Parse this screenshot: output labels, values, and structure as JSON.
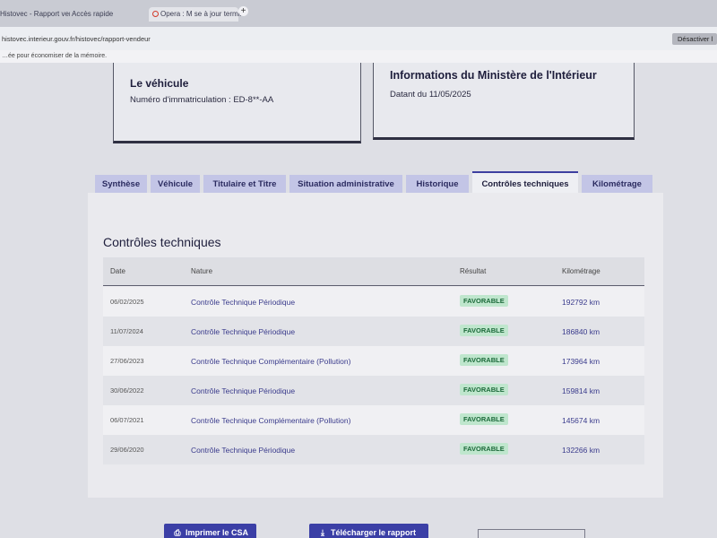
{
  "browser": {
    "tabs": [
      {
        "label": "Histovec - Rapport vende"
      },
      {
        "label": "Accès rapide"
      },
      {
        "label": "Opera : M se à jour termin"
      }
    ],
    "new_tab_symbol": "+",
    "url": "histovec.interieur.gouv.fr/histovec/rapport-vendeur",
    "disable_button": "Désactiver l",
    "infobar_text": "…ée pour économiser de la mémoire."
  },
  "vehicle_card": {
    "title": "Le véhicule",
    "plate_label": "Numéro d'immatriculation : ED-8**-AA"
  },
  "ministry_card": {
    "title": "Informations du Ministère de l'Intérieur",
    "date_label": "Datant du 11/05/2025"
  },
  "tabs": [
    {
      "label": "Synthèse",
      "active": false
    },
    {
      "label": "Véhicule",
      "active": false
    },
    {
      "label": "Titulaire et Titre",
      "active": false
    },
    {
      "label": "Situation administrative",
      "active": false
    },
    {
      "label": "Historique",
      "active": false
    },
    {
      "label": "Contrôles techniques",
      "active": true
    },
    {
      "label": "Kilométrage",
      "active": false
    }
  ],
  "section": {
    "title": "Contrôles techniques",
    "columns": [
      "Date",
      "Nature",
      "Résultat",
      "Kilométrage"
    ],
    "rows": [
      {
        "date": "06/02/2025",
        "nature": "Contrôle Technique Périodique",
        "result": "FAVORABLE",
        "km": "192792 km"
      },
      {
        "date": "11/07/2024",
        "nature": "Contrôle Technique Périodique",
        "result": "FAVORABLE",
        "km": "186840 km"
      },
      {
        "date": "27/06/2023",
        "nature": "Contrôle Technique Complémentaire (Pollution)",
        "result": "FAVORABLE",
        "km": "173964 km"
      },
      {
        "date": "30/06/2022",
        "nature": "Contrôle Technique Périodique",
        "result": "FAVORABLE",
        "km": "159814 km"
      },
      {
        "date": "06/07/2021",
        "nature": "Contrôle Technique Complémentaire (Pollution)",
        "result": "FAVORABLE",
        "km": "145674 km"
      },
      {
        "date": "29/06/2020",
        "nature": "Contrôle Technique Périodique",
        "result": "FAVORABLE",
        "km": "132266 km"
      }
    ]
  },
  "actions": {
    "print_label": "Imprimer le CSA",
    "download_label": "Télécharger le rapport"
  },
  "colors": {
    "accent": "#3b3fa6",
    "favorable_bg": "#bfe6cd",
    "favorable_text": "#1c6a3a"
  }
}
